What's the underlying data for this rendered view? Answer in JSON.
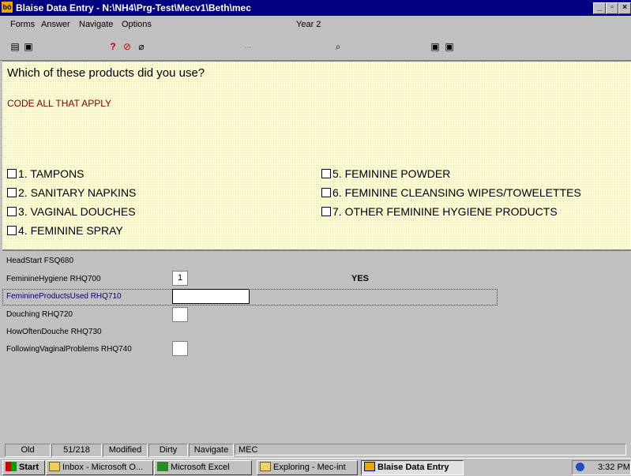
{
  "window": {
    "title": "Blaise Data Entry - N:\\NH4\\Prg-Test\\Mecv1\\Beth\\mec",
    "app_icon_text": "bö"
  },
  "menu": {
    "items": [
      "Forms",
      "Answer",
      "Navigate",
      "Options"
    ],
    "context": "Year 2"
  },
  "toolbar": {
    "dots": "..."
  },
  "question": {
    "text": "Which of these products did you use?",
    "instruction": "CODE ALL THAT APPLY"
  },
  "options": [
    {
      "label": "1. TAMPONS",
      "checked": false
    },
    {
      "label": "2. SANITARY NAPKINS",
      "checked": false
    },
    {
      "label": "3. VAGINAL DOUCHES",
      "checked": false
    },
    {
      "label": "4. FEMININE SPRAY",
      "checked": false
    },
    {
      "label": "5. FEMININE POWDER",
      "checked": false
    },
    {
      "label": "6. FEMININE CLEANSING WIPES/TOWELETTES",
      "checked": false
    },
    {
      "label": "7. OTHER FEMININE HYGIENE PRODUCTS",
      "checked": false
    }
  ],
  "fields": [
    {
      "label": "HeadStart FSQ680",
      "value": "",
      "has_box": false
    },
    {
      "label": "FeminineHygiene RHQ700",
      "value": "1",
      "has_box": true,
      "answer_text": "YES"
    },
    {
      "label": "FeminineProductsUsed RHQ710",
      "value": "",
      "has_box": true,
      "active": true
    },
    {
      "label": "Douching RHQ720",
      "value": "",
      "has_box": true
    },
    {
      "label": "HowOftenDouche RHQ730",
      "value": "",
      "has_box": false
    },
    {
      "label": "FollowingVaginalProblems RHQ740",
      "value": "",
      "has_box": true
    }
  ],
  "status": {
    "mode": "Old",
    "position": "51/218",
    "modified": "Modified",
    "dirty": "Dirty",
    "navigate": "Navigate",
    "block": "MEC"
  },
  "taskbar": {
    "start": "Start",
    "buttons": [
      {
        "label": "Inbox - Microsoft O...",
        "icon": "outlook-icon"
      },
      {
        "label": "Microsoft Excel",
        "icon": "excel-icon"
      },
      {
        "label": "Exploring - Mec-int",
        "icon": "explorer-icon"
      },
      {
        "label": "Blaise Data Entry",
        "icon": "blaise-icon",
        "active": true
      }
    ],
    "clock": "3:32 PM"
  },
  "colors": {
    "titlebar": "#000080",
    "pane_background": "#ffffd8",
    "instruction": "#800000",
    "active_field_label": "#000080"
  }
}
